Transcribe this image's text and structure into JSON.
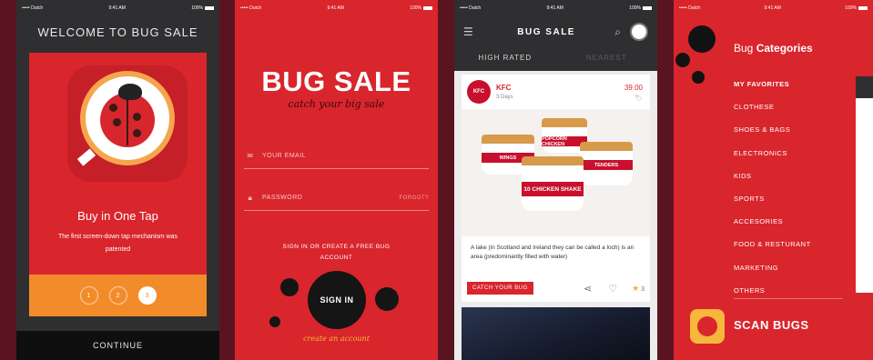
{
  "status": {
    "carrier": "••••• Dutch",
    "time": "9:41 AM",
    "battery": "100%"
  },
  "onboarding": {
    "title": "WELCOME TO BUG SALE",
    "heading": "Buy in One Tap",
    "description": "The first screen-down tap mechanism was patented",
    "pages": [
      "1",
      "2",
      "3"
    ],
    "active_page": 3,
    "continue_label": "CONTINUE"
  },
  "login": {
    "brand": "BUG SALE",
    "tagline": "catch your big sale",
    "email_placeholder": "YOUR EMAIL",
    "password_placeholder": "PASSWORD",
    "forgot_label": "FORGOT?",
    "signin_prompt": "SIGN IN OR CREATE A FREE BUG ACCOUNT",
    "signin_label": "SIGN IN",
    "create_label": "create an account"
  },
  "feed": {
    "title": "BUG SALE",
    "tabs": [
      {
        "label": "HIGH RATED",
        "active": true
      },
      {
        "label": "NEAREST",
        "active": false
      }
    ],
    "post": {
      "avatar_text": "KFC",
      "brand": "KFC",
      "posted": "3 Days",
      "price": "39.00",
      "buckets": [
        "POPCORN CHICKEN",
        "WINGS",
        "10 CHICKEN SHAKE",
        "TENDERS"
      ],
      "caption": "A lake (in Scotland and Ireland they can be called a loch) is an area (predominantly filled with water)",
      "catch_label": "CATCH YOUR BUG",
      "stars": "3"
    }
  },
  "categories": {
    "title_prefix": "Bug",
    "title_bold": "Categories",
    "items": [
      {
        "label": "MY FAVORITES",
        "bold": true
      },
      {
        "label": "CLOTHESE",
        "bold": false
      },
      {
        "label": "SHOES & BAGS",
        "bold": false
      },
      {
        "label": "ELECTRONICS",
        "bold": false
      },
      {
        "label": "KIDS",
        "bold": false
      },
      {
        "label": "SPORTS",
        "bold": false
      },
      {
        "label": "ACCESORIES",
        "bold": false
      },
      {
        "label": "FOOD & RESTURANT",
        "bold": false
      },
      {
        "label": "MARKETING",
        "bold": false
      },
      {
        "label": "OTHERS",
        "bold": false
      }
    ],
    "scan_label": "SCAN BUGS"
  },
  "colors": {
    "background": "#5a1420",
    "brand_red": "#d9252c",
    "orange": "#f28c2b",
    "dark": "#2f2f31",
    "yellow": "#f5b73c"
  }
}
